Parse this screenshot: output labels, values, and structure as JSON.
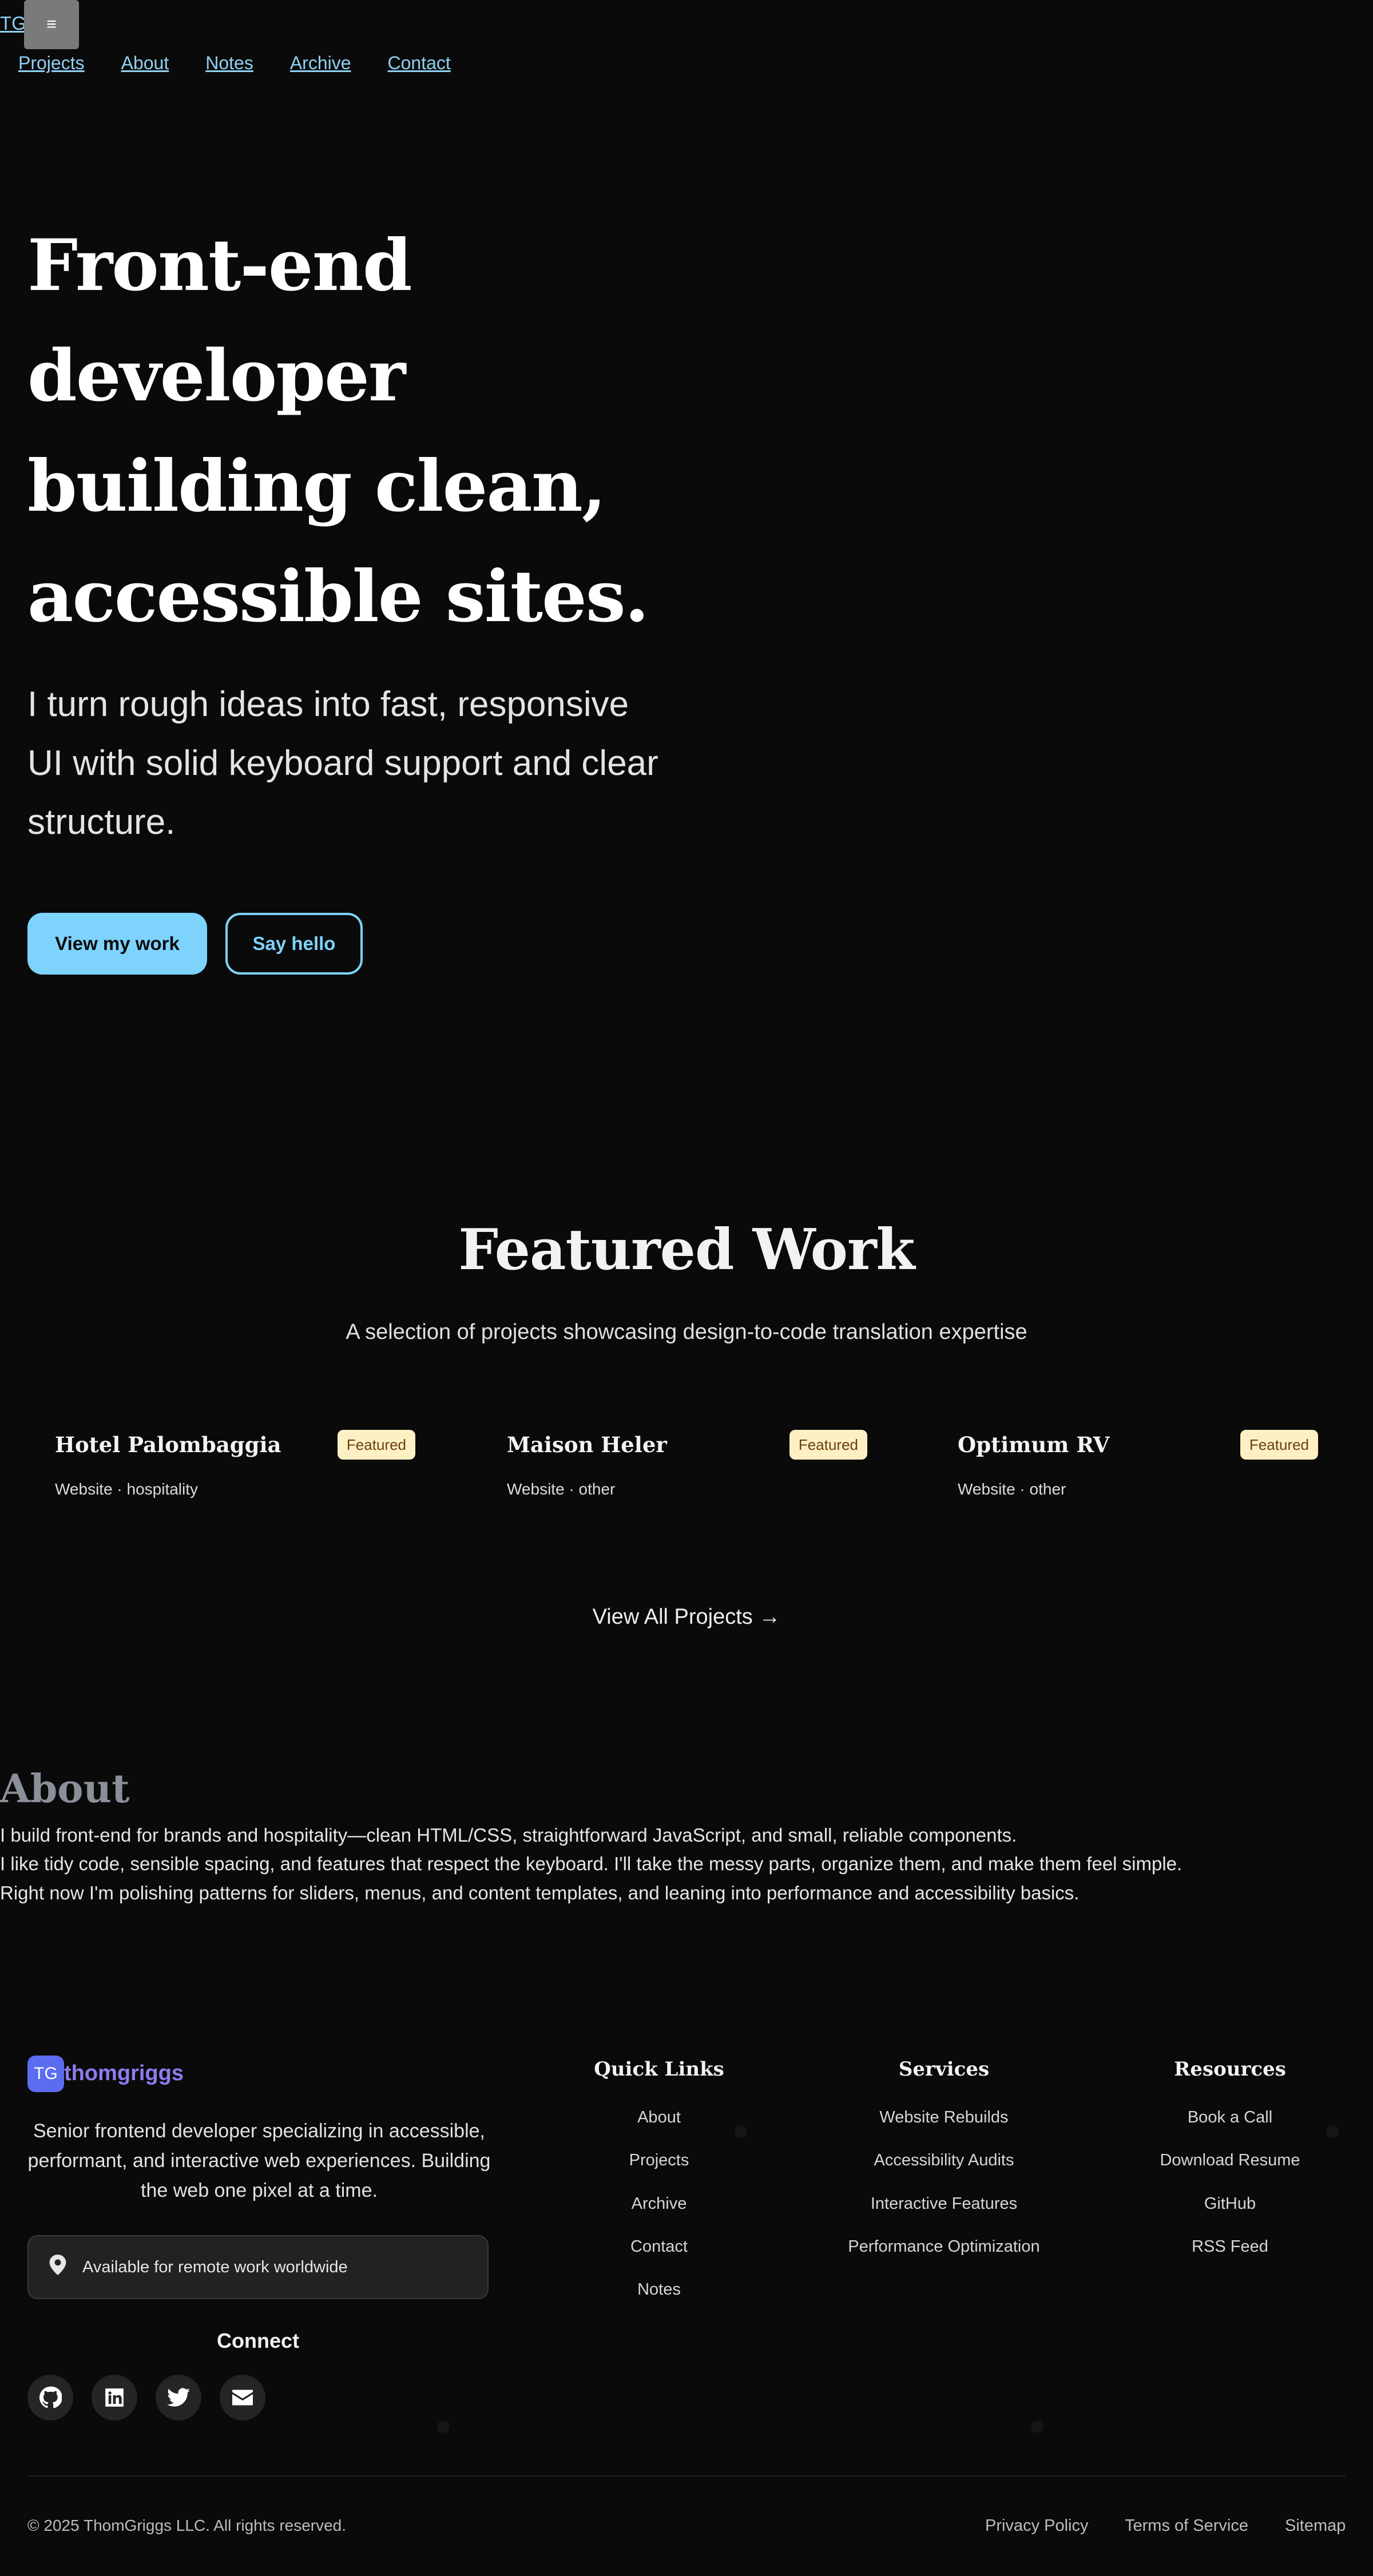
{
  "header": {
    "logo_text": "TG",
    "menu_icon": "≡",
    "nav": [
      "Projects",
      "About",
      "Notes",
      "Archive",
      "Contact"
    ]
  },
  "hero": {
    "title": "Front-end developer building clean, accessible sites.",
    "subtitle": "I turn rough ideas into fast, responsive UI with solid keyboard support and clear structure.",
    "primary_cta": "View my work",
    "secondary_cta": "Say hello"
  },
  "featured": {
    "title": "Featured Work",
    "subtitle": "A selection of projects showcasing design-to-code translation expertise",
    "projects": [
      {
        "name": "Hotel Palombaggia",
        "badge": "Featured",
        "meta": "Website · hospitality"
      },
      {
        "name": "Maison Heler",
        "badge": "Featured",
        "meta": "Website · other"
      },
      {
        "name": "Optimum RV",
        "badge": "Featured",
        "meta": "Website · other"
      }
    ],
    "view_all": "View All Projects →"
  },
  "about": {
    "title": "About",
    "paragraphs": [
      "I build front-end for brands and hospitality—clean HTML/CSS, straightforward JavaScript, and small, reliable components.",
      "I like tidy code, sensible spacing, and features that respect the keyboard. I'll take the messy parts, organize them, and make them feel simple.",
      "Right now I'm polishing patterns for sliders, menus, and content templates, and leaning into performance and accessibility basics."
    ]
  },
  "footer": {
    "logo_text": "TG",
    "brand": "thomgriggs",
    "description": "Senior frontend developer specializing in accessible, performant, and interactive web experiences. Building the web one pixel at a time.",
    "availability": "Available for remote work worldwide",
    "connect_title": "Connect",
    "social": [
      "github-icon",
      "linkedin-icon",
      "twitter-icon",
      "email-icon"
    ],
    "quick_links": {
      "title": "Quick Links",
      "items": [
        "About",
        "Projects",
        "Archive",
        "Contact",
        "Notes"
      ]
    },
    "services": {
      "title": "Services",
      "items": [
        "Website Rebuilds",
        "Accessibility Audits",
        "Interactive Features",
        "Performance Optimization"
      ]
    },
    "resources": {
      "title": "Resources",
      "items": [
        "Book a Call",
        "Download Resume",
        "GitHub",
        "RSS Feed"
      ]
    },
    "copyright": "© 2025 ThomGriggs LLC. All rights reserved.",
    "legal": [
      "Privacy Policy",
      "Terms of Service",
      "Sitemap"
    ]
  },
  "colors": {
    "accent": "#7dd3fc",
    "badge_bg": "#fdf0c4",
    "brand": "#8c7cf0",
    "background": "#0a0a0a"
  }
}
